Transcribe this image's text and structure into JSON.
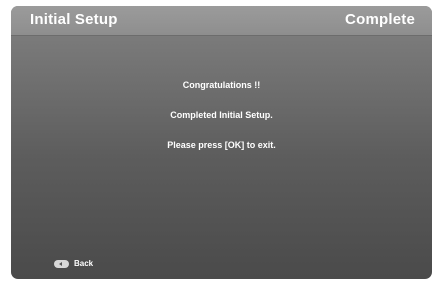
{
  "header": {
    "title": "Initial Setup",
    "status": "Complete"
  },
  "messages": [
    "Congratulations !!",
    "Completed Initial Setup.",
    "Please press [OK] to exit."
  ],
  "footer": {
    "back_label": "Back",
    "back_icon": "back-arrow-icon"
  }
}
